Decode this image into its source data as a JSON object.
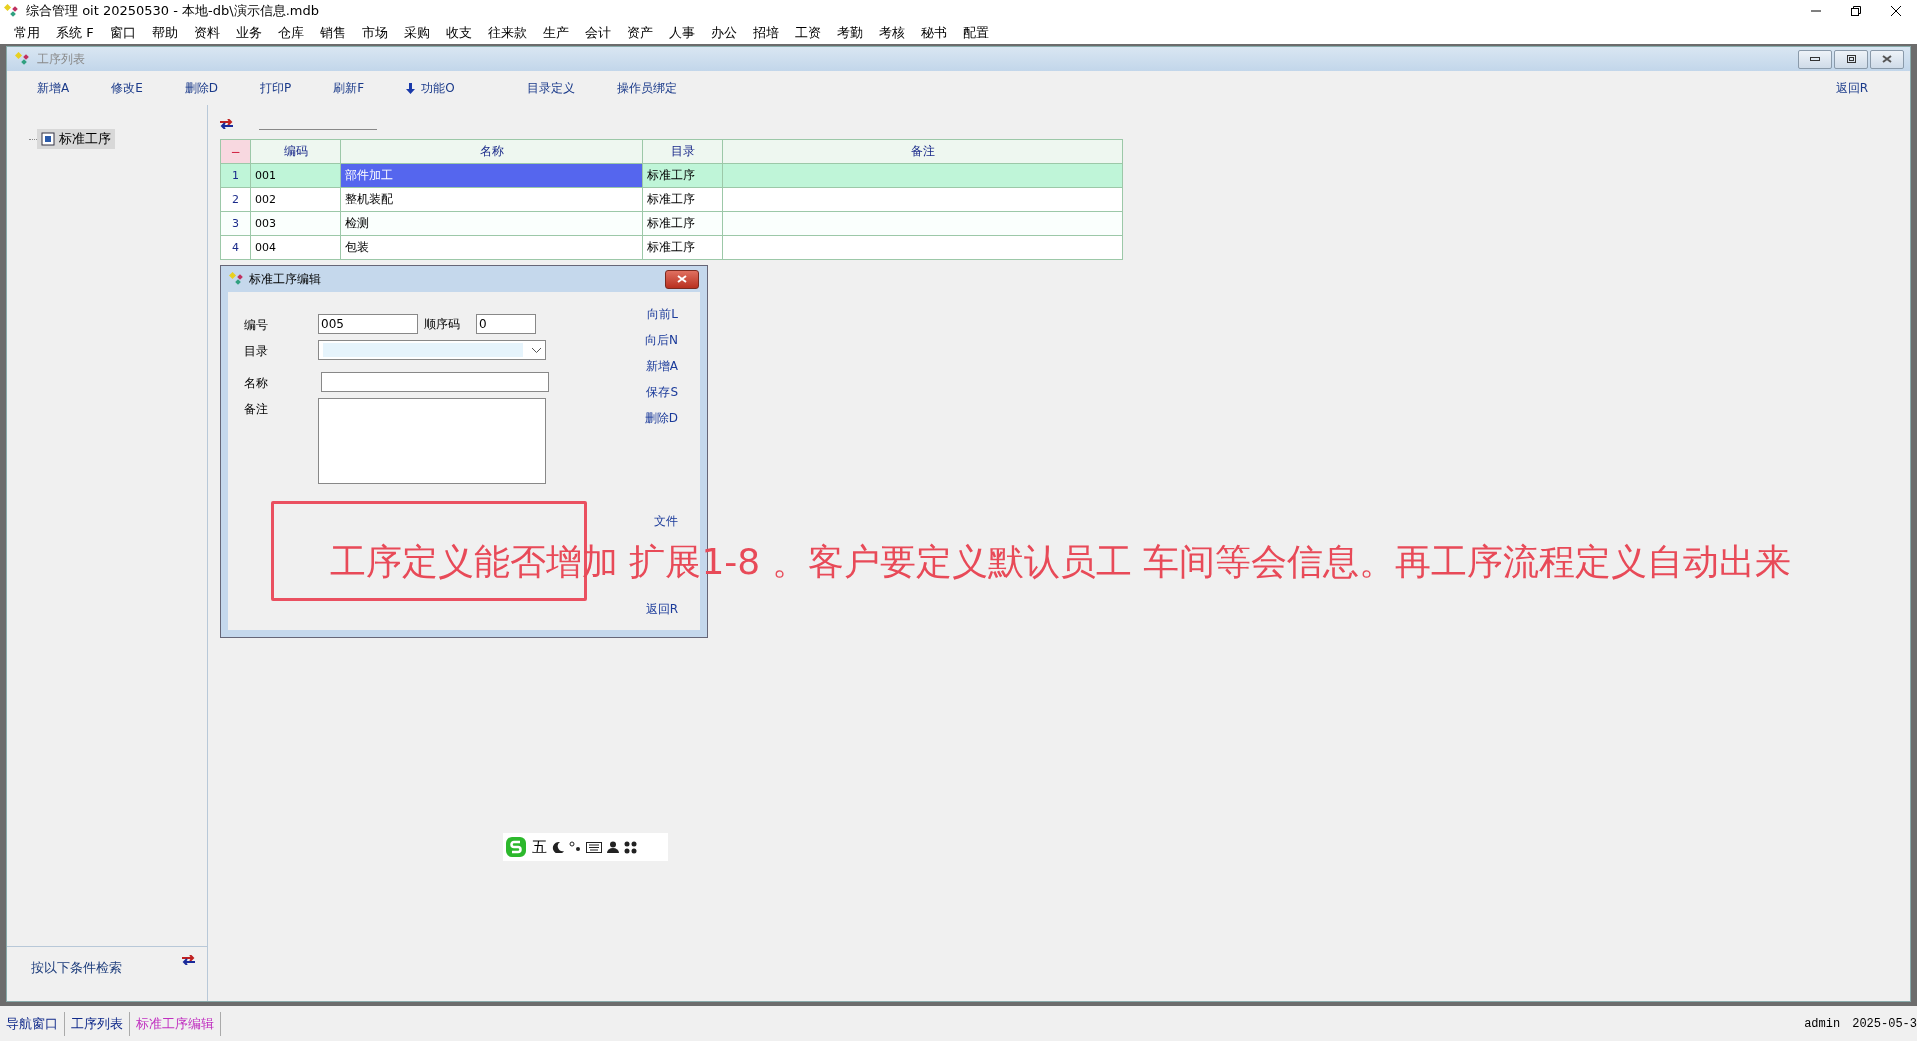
{
  "app_window": {
    "title": "综合管理 oit 20250530 - 本地-db\\演示信息.mdb"
  },
  "menu": [
    "常用",
    "系统 F",
    "窗口",
    "帮助",
    "资料",
    "业务",
    "仓库",
    "销售",
    "市场",
    "采购",
    "收支",
    "往来款",
    "生产",
    "会计",
    "资产",
    "人事",
    "办公",
    "招培",
    "工资",
    "考勤",
    "考核",
    "秘书",
    "配置"
  ],
  "child_window": {
    "title": "工序列表",
    "toolbar": [
      {
        "label": "新增A",
        "kind": "plain"
      },
      {
        "label": "修改E",
        "kind": "plain"
      },
      {
        "label": "删除D",
        "kind": "plain"
      },
      {
        "label": "打印P",
        "kind": "plain"
      },
      {
        "label": "刷新F",
        "kind": "plain"
      },
      {
        "label": "功能O",
        "kind": "arrow"
      },
      {
        "label": "目录定义",
        "kind": "plain"
      },
      {
        "label": "操作员绑定",
        "kind": "plain"
      }
    ],
    "back_button": "返回R",
    "tree": [
      {
        "label": "标准工序",
        "selected": true
      }
    ],
    "search_label": "按以下条件检索",
    "table": {
      "corner": "−",
      "columns": [
        "编码",
        "名称",
        "目录",
        "备注"
      ],
      "rows": [
        {
          "num": "1",
          "cells": [
            "001",
            "部件加工",
            "标准工序",
            ""
          ],
          "selected": true
        },
        {
          "num": "2",
          "cells": [
            "002",
            "整机装配",
            "标准工序",
            ""
          ],
          "selected": false
        },
        {
          "num": "3",
          "cells": [
            "003",
            "检测",
            "标准工序",
            ""
          ],
          "selected": false
        },
        {
          "num": "4",
          "cells": [
            "004",
            "包装",
            "标准工序",
            ""
          ],
          "selected": false
        }
      ]
    }
  },
  "dialog": {
    "title": "标准工序编辑",
    "code_label": "编号",
    "code_value": "005",
    "order_label": "顺序码",
    "order_value": "0",
    "category_label": "目录",
    "name_label": "名称",
    "note_label": "备注",
    "buttons": [
      "向前L",
      "向后N",
      "新增A",
      "保存S",
      "删除D",
      "文件"
    ],
    "back_button": "返回R"
  },
  "annotation": {
    "text": "工序定义能否增加 扩展1-8 。客户要定义默认员工 车间等会信息。再工序流程定义自动出来"
  },
  "ime_toolbar": {
    "mode": "五"
  },
  "status_bar": {
    "tabs": [
      {
        "label": "导航窗口",
        "selected": false
      },
      {
        "label": "工序列表",
        "selected": false
      },
      {
        "label": "标准工序编辑",
        "selected": true
      }
    ],
    "user": "admin",
    "date": "2025-05-3"
  }
}
